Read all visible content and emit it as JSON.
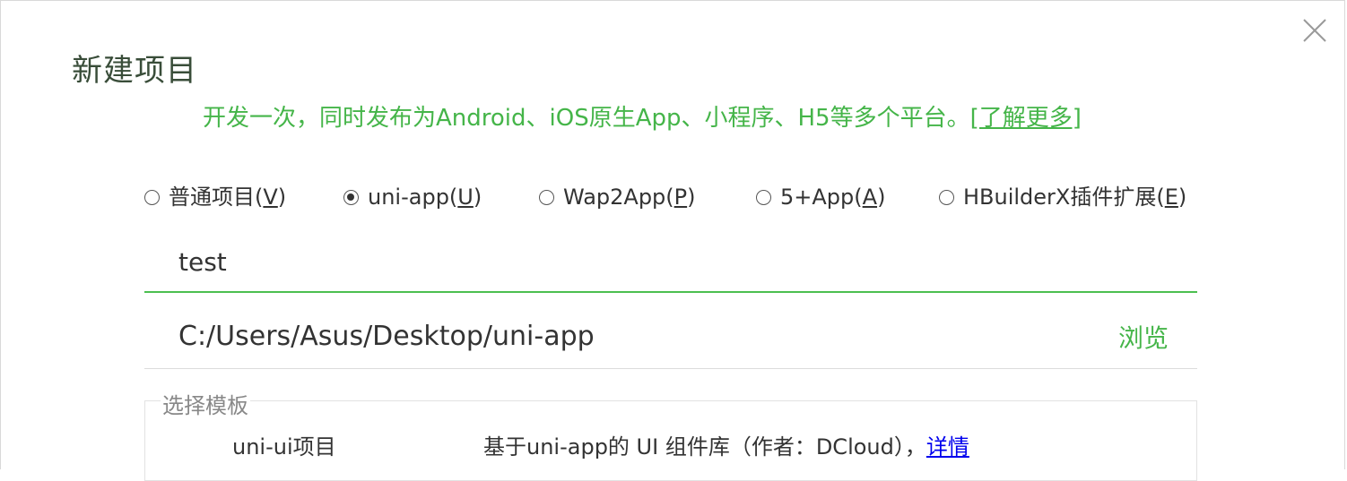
{
  "dialog": {
    "title": "新建项目",
    "subtitle_text": "开发一次，同时发布为Android、iOS原生App、小程序、H5等多个平台。",
    "subtitle_link": "[了解更多]",
    "close_icon": "close-icon"
  },
  "project_types": [
    {
      "label": "普通项目(",
      "key": "V",
      "suffix": ")",
      "selected": false
    },
    {
      "label": "uni-app(",
      "key": "U",
      "suffix": ")",
      "selected": true
    },
    {
      "label": "Wap2App(",
      "key": "P",
      "suffix": ")",
      "selected": false
    },
    {
      "label": "5+App(",
      "key": "A",
      "suffix": ")",
      "selected": false
    },
    {
      "label": "HBuilderX插件扩展(",
      "key": "E",
      "suffix": ")",
      "selected": false
    }
  ],
  "project_name": {
    "value": "test"
  },
  "project_path": {
    "value": "C:/Users/Asus/Desktop/uni-app",
    "browse_label": "浏览"
  },
  "template": {
    "legend": "选择模板",
    "items": [
      {
        "name": "uni-ui项目",
        "description": "基于uni-app的 UI 组件库（作者：DCloud），",
        "link": "详情"
      }
    ]
  },
  "colors": {
    "accent": "#45b549",
    "title": "#394d39",
    "link": "#0000ee"
  }
}
